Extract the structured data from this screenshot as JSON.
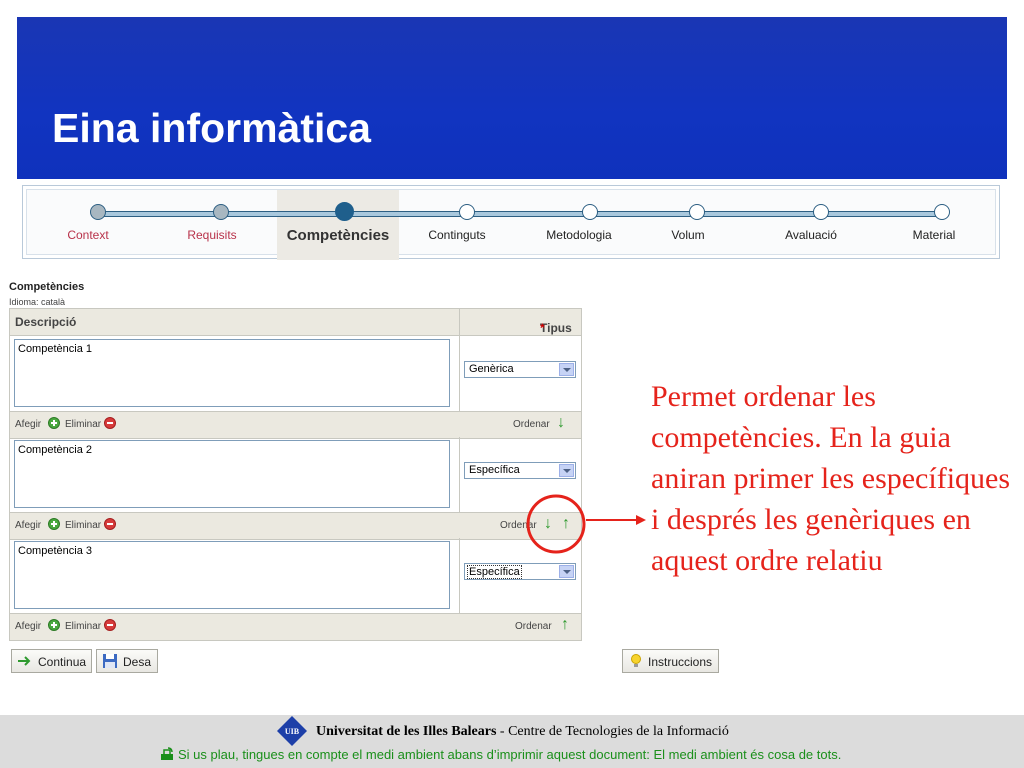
{
  "header": {
    "title": "Eina informàtica"
  },
  "stepper": {
    "steps": [
      {
        "label": "Context",
        "state": "done"
      },
      {
        "label": "Requisits",
        "state": "done"
      },
      {
        "label": "Competències",
        "state": "current"
      },
      {
        "label": "Continguts",
        "state": "todo"
      },
      {
        "label": "Metodologia",
        "state": "todo"
      },
      {
        "label": "Volum",
        "state": "todo"
      },
      {
        "label": "Avaluació",
        "state": "todo"
      },
      {
        "label": "Material",
        "state": "todo"
      }
    ]
  },
  "section": {
    "title": "Competències",
    "language": "Idioma: català"
  },
  "table": {
    "col_description": "Descripció",
    "col_type": "Tipus",
    "required_mark": "*",
    "rows": [
      {
        "description": "Competència 1",
        "type": "Genèrica"
      },
      {
        "description": "Competència 2",
        "type": "Específica"
      },
      {
        "description": "Competència 3",
        "type": "Específica"
      }
    ],
    "add_label": "Afegir",
    "delete_label": "Eliminar",
    "order_label": "Ordenar"
  },
  "buttons": {
    "continue": "Continua",
    "save": "Desa",
    "instructions": "Instruccions"
  },
  "annotation": "Permet ordenar les competències. En la guia aniran primer les específiques i després les genèriques en aquest ordre relatiu",
  "footer": {
    "university": "Universitat de les Illes Balears",
    "center": " - Centre de Tecnologies de la Informació",
    "logo_text": "UIB",
    "environment": "Si us plau, tingues en compte el medi ambient abans d’imprimir aquest document: El medi ambient és cosa de tots."
  },
  "colors": {
    "header": "#1134c0",
    "annotation": "#e5231b",
    "environment": "#1a8f1a"
  }
}
